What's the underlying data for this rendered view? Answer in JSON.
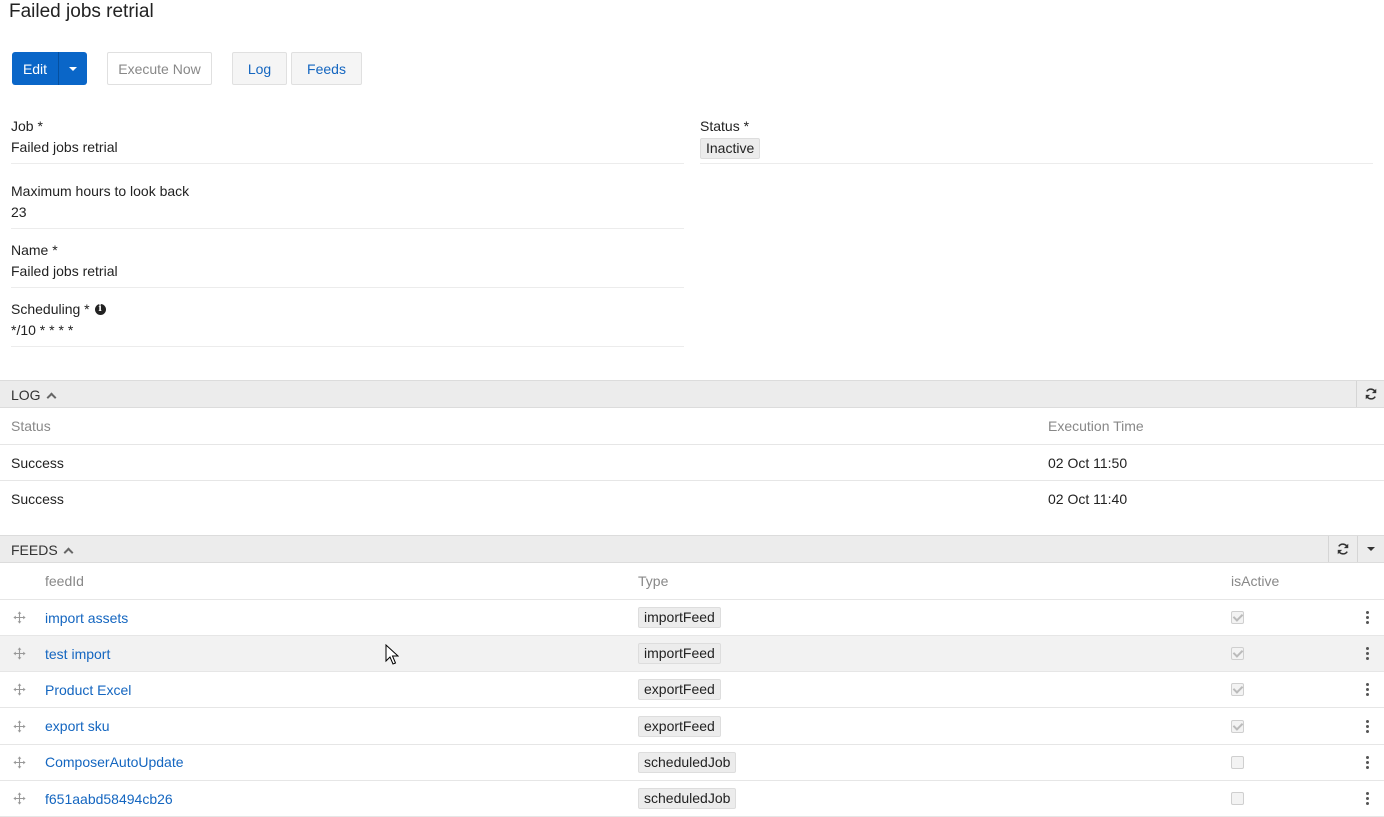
{
  "page": {
    "title": "Failed jobs retrial"
  },
  "toolbar": {
    "edit_label": "Edit",
    "execute_label": "Execute Now",
    "log_label": "Log",
    "feeds_label": "Feeds"
  },
  "fields": {
    "job": {
      "label": "Job *",
      "value": "Failed jobs retrial"
    },
    "max_hours": {
      "label": "Maximum hours to look back",
      "value": "23"
    },
    "name": {
      "label": "Name *",
      "value": "Failed jobs retrial"
    },
    "scheduling": {
      "label": "Scheduling *",
      "value": "*/10 * * * *",
      "icon": "info-icon"
    },
    "status": {
      "label": "Status *",
      "value": "Inactive"
    }
  },
  "log_panel": {
    "title": "LOG",
    "columns": {
      "status": "Status",
      "execution_time": "Execution Time"
    },
    "rows": [
      {
        "status": "Success",
        "time": "02 Oct 11:50"
      },
      {
        "status": "Success",
        "time": "02 Oct 11:40"
      }
    ]
  },
  "feeds_panel": {
    "title": "FEEDS",
    "columns": {
      "feed_id": "feedId",
      "type": "Type",
      "is_active": "isActive"
    },
    "rows": [
      {
        "feed_id": "import assets",
        "type": "importFeed",
        "is_active": true
      },
      {
        "feed_id": "test import",
        "type": "importFeed",
        "is_active": true
      },
      {
        "feed_id": "Product Excel",
        "type": "exportFeed",
        "is_active": true
      },
      {
        "feed_id": "export sku",
        "type": "exportFeed",
        "is_active": true
      },
      {
        "feed_id": "ComposerAutoUpdate",
        "type": "scheduledJob",
        "is_active": false
      },
      {
        "feed_id": "f651aabd58494cb26",
        "type": "scheduledJob",
        "is_active": false
      }
    ]
  },
  "colors": {
    "primary": "#0a66c8",
    "link": "#1466c0",
    "panel_header": "#ececec"
  }
}
